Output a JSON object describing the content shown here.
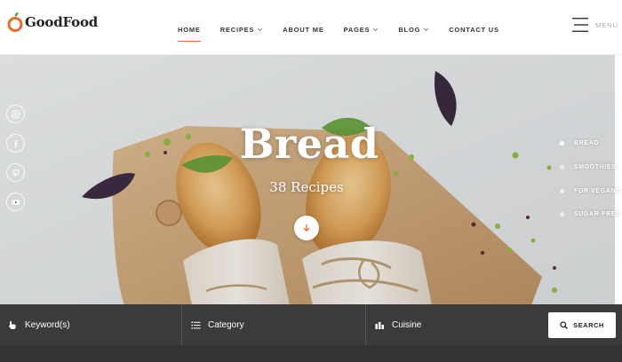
{
  "brand": {
    "name": "GoodFood",
    "accent": "#e96b2f",
    "leaf": "#3fa34d"
  },
  "nav": {
    "items": [
      {
        "label": "HOME",
        "active": true,
        "dropdown": false
      },
      {
        "label": "RECIPES",
        "active": false,
        "dropdown": true
      },
      {
        "label": "ABOUT ME",
        "active": false,
        "dropdown": false
      },
      {
        "label": "PAGES",
        "active": false,
        "dropdown": true
      },
      {
        "label": "BLOG",
        "active": false,
        "dropdown": true
      },
      {
        "label": "CONTACT US",
        "active": false,
        "dropdown": false
      }
    ],
    "menu_label": "MENU"
  },
  "social": [
    "instagram-icon",
    "facebook-icon",
    "pinterest-icon",
    "youtube-icon"
  ],
  "hero": {
    "title": "Bread",
    "subtitle": "38 Recipes",
    "slides": [
      {
        "label": "BREAD",
        "active": true
      },
      {
        "label": "SMOOTHIES",
        "active": false
      },
      {
        "label": "FOR VEGANS",
        "active": false
      },
      {
        "label": "SUGAR-FREE",
        "active": false
      }
    ]
  },
  "search": {
    "keyword_label": "Keyword(s)",
    "category_label": "Category",
    "cuisine_label": "Cuisine",
    "button_label": "SEARCH"
  }
}
